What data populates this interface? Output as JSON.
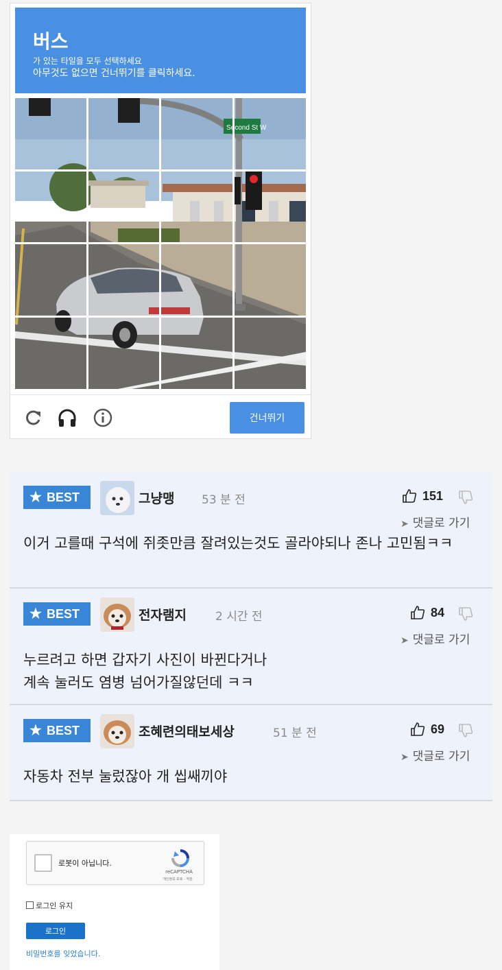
{
  "captcha": {
    "title": "버스",
    "instruction": "가 있는 타일을 모두 선택하세요",
    "skip_hint": "아무것도 없으면 건너뛰기를 클릭하세요.",
    "street_sign": "Second St W",
    "skip_button": "건너뛰기",
    "controls": [
      "reload-icon",
      "headphones-icon",
      "info-icon"
    ],
    "accent_color": "#4a90e2"
  },
  "comments": [
    {
      "badge": "BEST",
      "username": "그냥맹",
      "time": "53 분 전",
      "likes": "151",
      "goto": "댓글로 가기",
      "text": "이거 고를때 구석에 쥐좃만큼 잘려있는것도 골라야되나 존나 고민됨ㅋㅋ"
    },
    {
      "badge": "BEST",
      "username": "전자램지",
      "time": "2 시간 전",
      "likes": "84",
      "goto": "댓글로 가기",
      "text": "누르려고 하면 갑자기 사진이 바뀐다거나\n계속 눌러도 염병 넘어가질않던데 ㅋㅋ"
    },
    {
      "badge": "BEST",
      "username": "조혜련의태보세상",
      "time": "51 분 전",
      "likes": "69",
      "goto": "댓글로 가기",
      "text": "자동차 전부 눌렀잖아 개 씹쌔끼야"
    }
  ],
  "login": {
    "recaptcha_label": "로봇이 아닙니다.",
    "recaptcha_brand": "reCAPTCHA",
    "recaptcha_links": "개인정보 보호 - 약관",
    "keep_login": "로그인 유지",
    "login_button": "로그인",
    "forgot_password": "비밀번호를 잊었습니다."
  }
}
